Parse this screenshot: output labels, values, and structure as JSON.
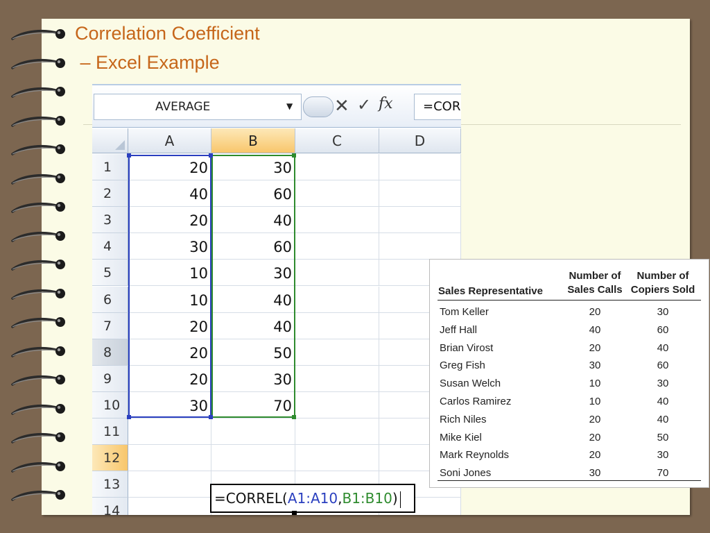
{
  "slide": {
    "title_line1": "Correlation Coefficient",
    "title_line2": " – Excel Example"
  },
  "excel": {
    "name_box": "AVERAGE",
    "formula_bar_text": "=COR",
    "columns": [
      "A",
      "B",
      "C",
      "D"
    ],
    "active_column": "B",
    "rows": [
      1,
      2,
      3,
      4,
      5,
      6,
      7,
      8,
      9,
      10,
      11,
      12,
      13,
      14
    ],
    "active_row": 12,
    "column_a": [
      20,
      40,
      20,
      30,
      10,
      10,
      20,
      20,
      20,
      30
    ],
    "column_b": [
      30,
      60,
      40,
      60,
      30,
      40,
      40,
      50,
      30,
      70
    ],
    "edit_cell": {
      "part1": "=CORREL(",
      "part2": "A1:A10",
      "part3": ",",
      "part4": "B1:B10",
      "part5": ")"
    }
  },
  "table": {
    "headers": {
      "col1": "Sales Representative",
      "col2_line1": "Number of",
      "col2_line2": "Sales Calls",
      "col3_line1": "Number of",
      "col3_line2": "Copiers Sold"
    },
    "rows": [
      {
        "name": "Tom Keller",
        "calls": "20",
        "sold": "30"
      },
      {
        "name": "Jeff Hall",
        "calls": "40",
        "sold": "60"
      },
      {
        "name": "Brian Virost",
        "calls": "20",
        "sold": "40"
      },
      {
        "name": "Greg Fish",
        "calls": "30",
        "sold": "60"
      },
      {
        "name": "Susan Welch",
        "calls": "10",
        "sold": "30"
      },
      {
        "name": "Carlos Ramirez",
        "calls": "10",
        "sold": "40"
      },
      {
        "name": "Rich Niles",
        "calls": "20",
        "sold": "40"
      },
      {
        "name": "Mike Kiel",
        "calls": "20",
        "sold": "50"
      },
      {
        "name": "Mark Reynolds",
        "calls": "20",
        "sold": "30"
      },
      {
        "name": "Soni Jones",
        "calls": "30",
        "sold": "70"
      }
    ]
  }
}
